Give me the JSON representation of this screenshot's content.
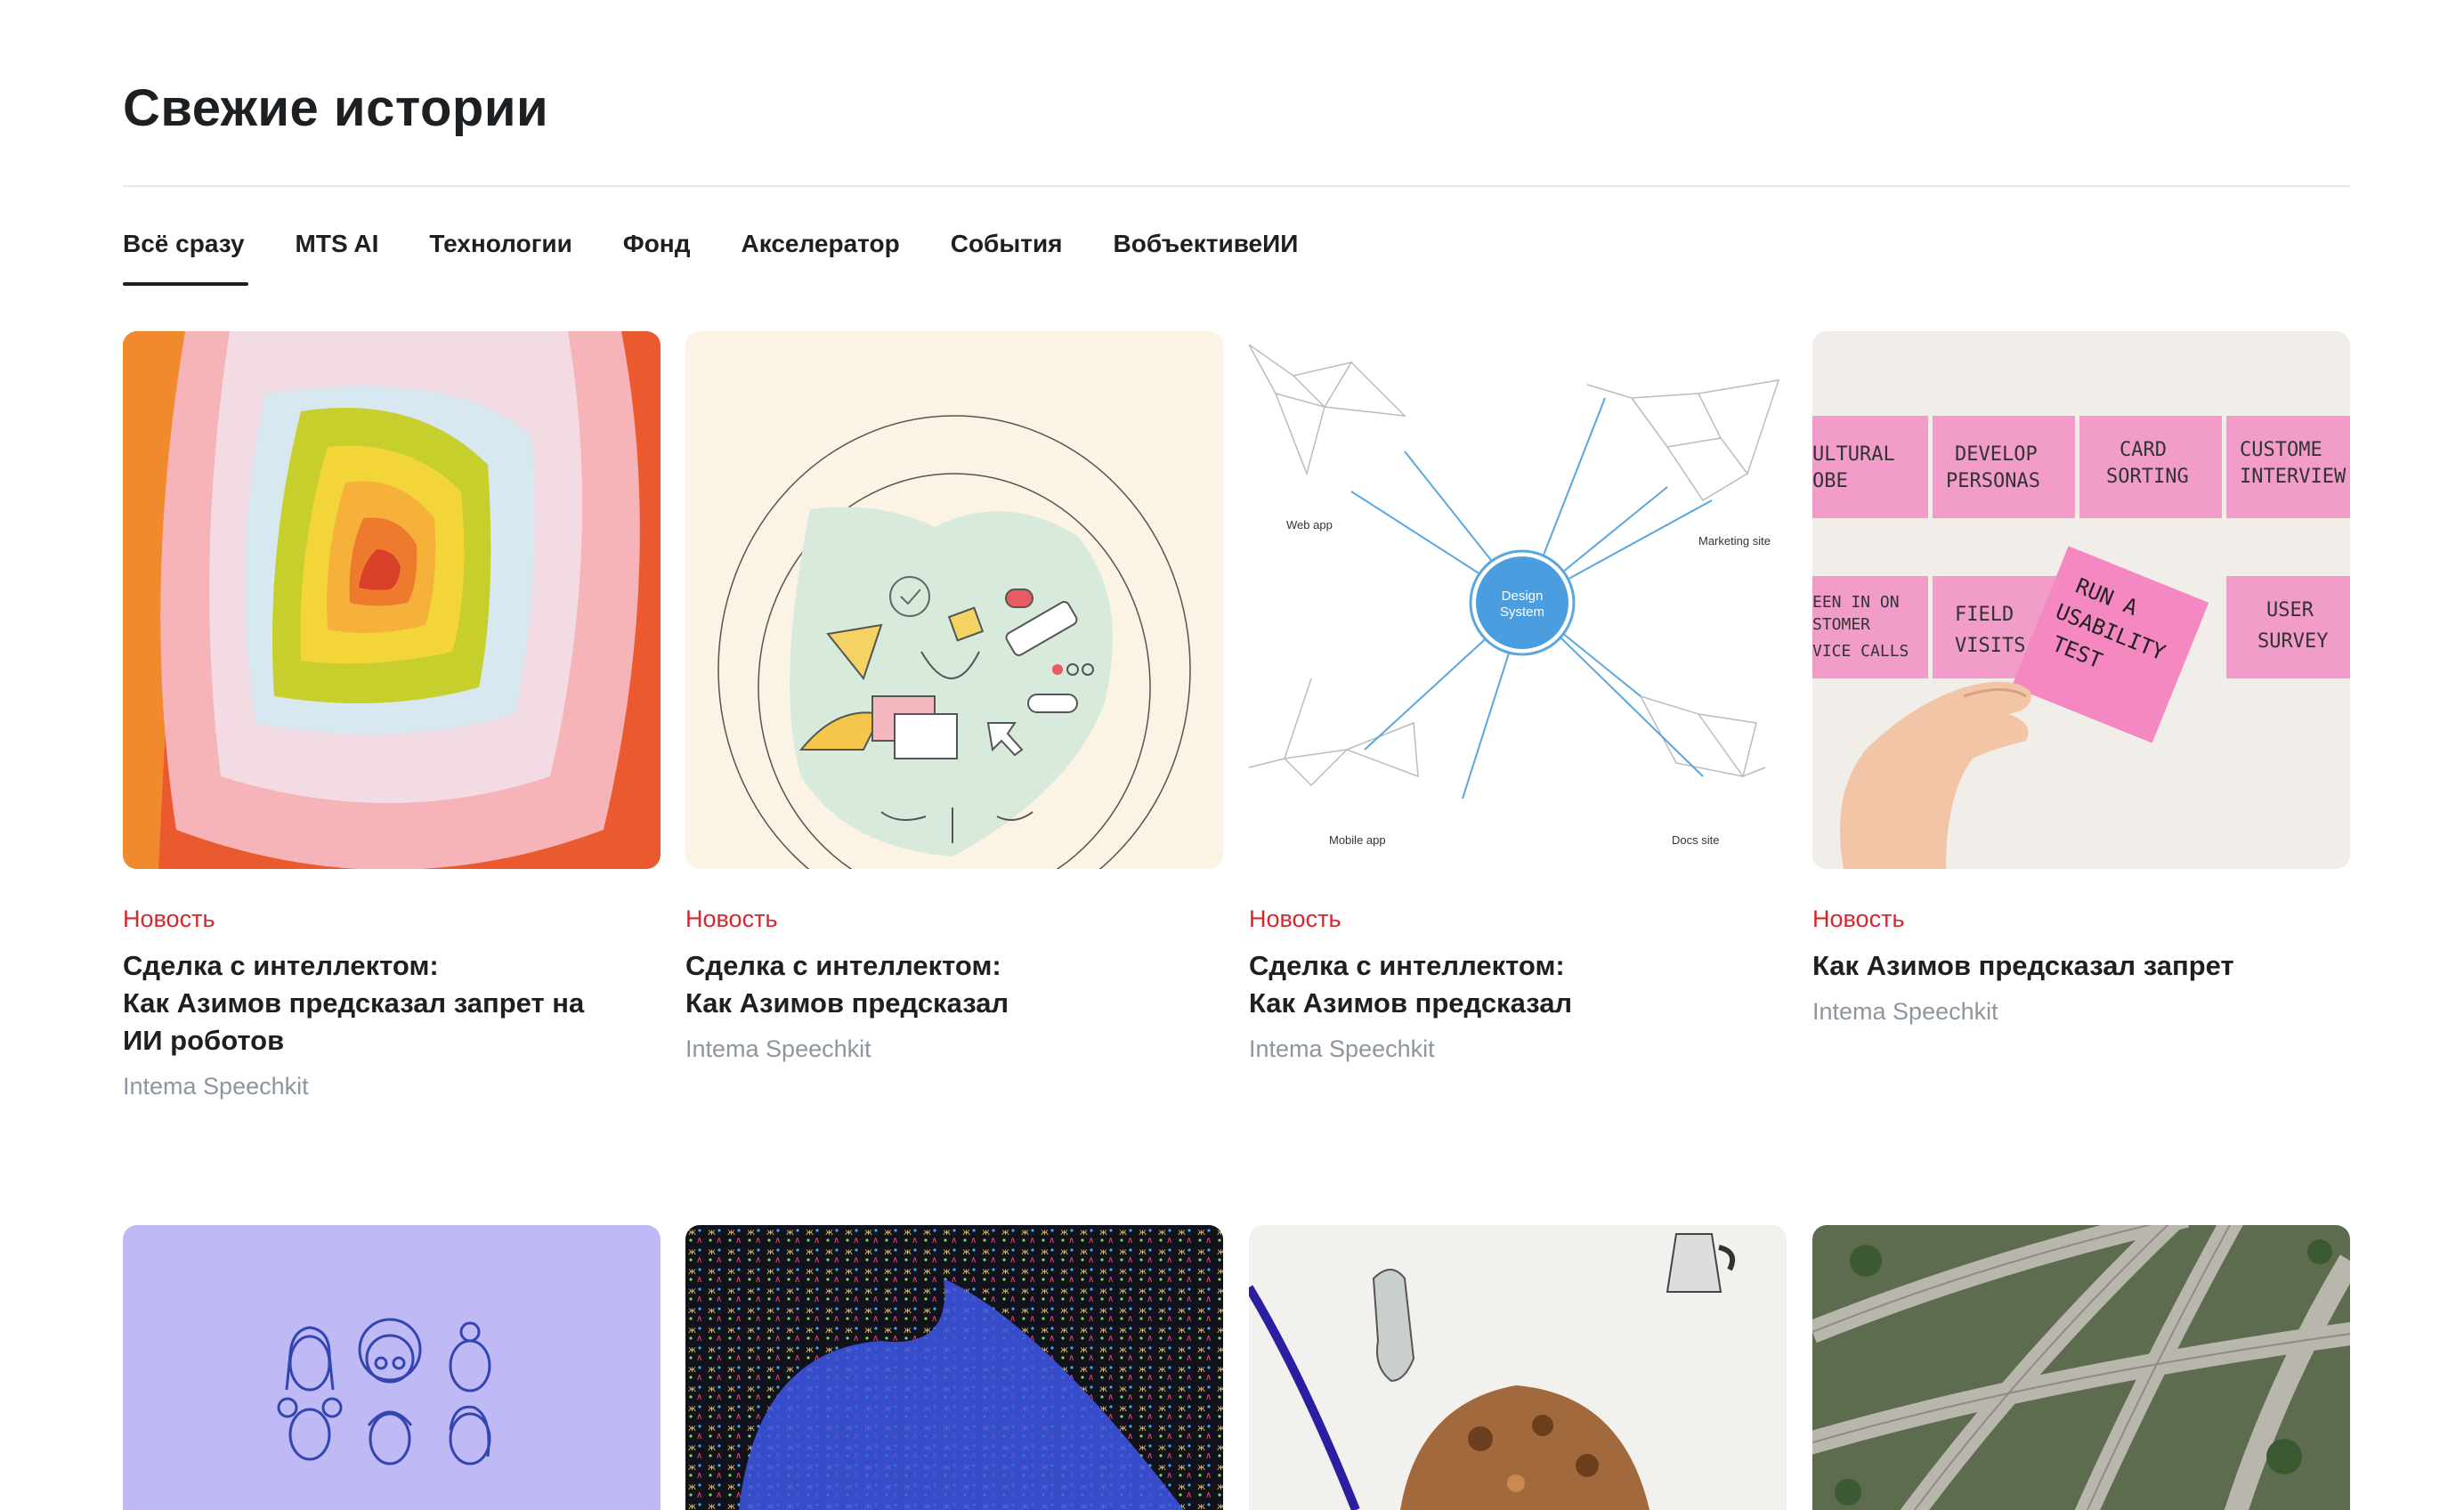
{
  "page": {
    "title": "Свежие истории"
  },
  "tabs": [
    {
      "label": "Всё сразу",
      "active": true
    },
    {
      "label": "MTS AI",
      "active": false
    },
    {
      "label": "Технологии",
      "active": false
    },
    {
      "label": "Фонд",
      "active": false
    },
    {
      "label": "Акселератор",
      "active": false
    },
    {
      "label": "События",
      "active": false
    },
    {
      "label": "ВобъективеИИ",
      "active": false
    }
  ],
  "cards": [
    {
      "tag": "Новость",
      "title": "Сделка с интеллектом:\nКак Азимов предсказал запрет на\nИИ роботов",
      "author": "Intema Speechkit",
      "image": "abstract-concentric-shapes"
    },
    {
      "tag": "Новость",
      "title": "Сделка с интеллектом:\nКак Азимов предсказал",
      "author": "Intema Speechkit",
      "image": "design-tools-illustration"
    },
    {
      "tag": "Новость",
      "title": "Сделка с интеллектом:\nКак Азимов предсказал",
      "author": "Intema Speechkit",
      "image": "design-system-network",
      "image_labels": {
        "center": [
          "Design",
          "System"
        ],
        "web": "Web app",
        "marketing": "Marketing site",
        "mobile": "Mobile app",
        "docs": "Docs site"
      }
    },
    {
      "tag": "Новость",
      "title": "Как Азимов предсказал запрет",
      "author": "Intema Speechkit",
      "image": "sticky-notes-photo",
      "image_labels": {
        "n1": [
          "ULTURAL",
          "OBE"
        ],
        "n2": [
          "DEVELOP",
          "PERSONAS"
        ],
        "n3": [
          "CARD",
          "SORTING"
        ],
        "n4": [
          "CUSTOME",
          "INTERVIEW"
        ],
        "n5": [
          "EEN IN ON",
          "STOMER",
          "VICE CALLS"
        ],
        "n6": [
          "FIELD",
          "VISITS"
        ],
        "n7": [
          "USER",
          "SURVEY"
        ],
        "n8": [
          "RUN A",
          "USABILITY",
          "TEST"
        ]
      }
    },
    {
      "image": "faces-illustration"
    },
    {
      "image": "pattern-blue-shape"
    },
    {
      "image": "cookie-illustration"
    },
    {
      "image": "highway-aerial-photo"
    }
  ],
  "colors": {
    "accent_tag": "#d7262e",
    "text_primary": "#1d2023",
    "text_secondary": "#8d969f",
    "divider": "#e6e8eb"
  }
}
